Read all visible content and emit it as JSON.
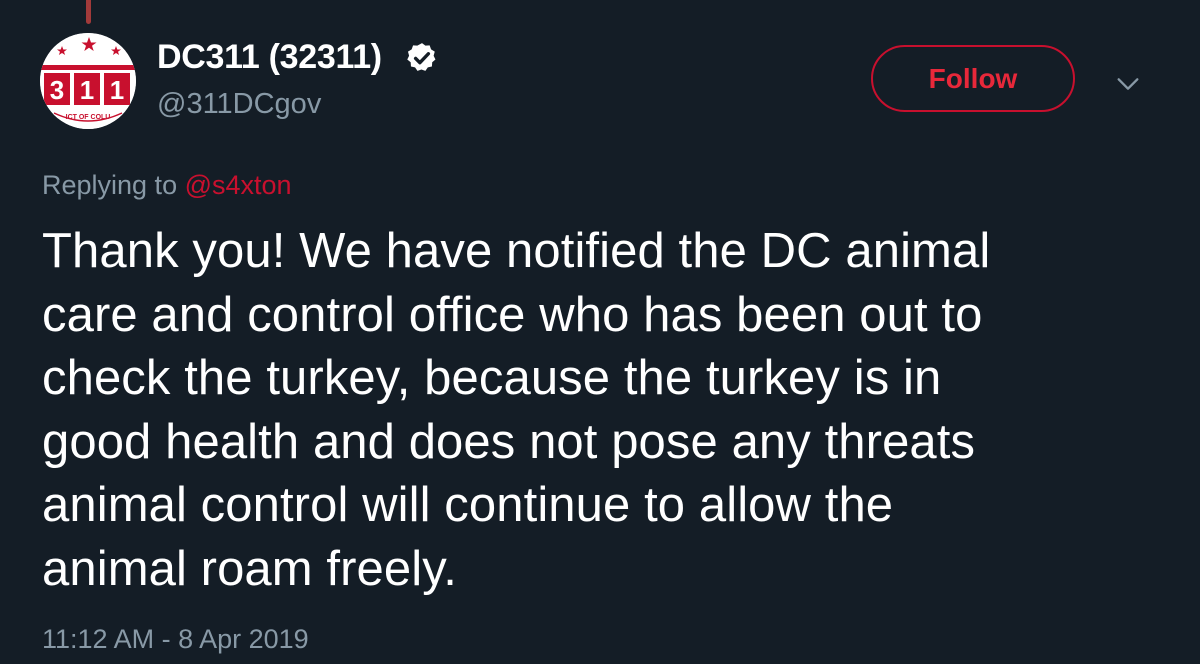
{
  "colors": {
    "background": "#141d26",
    "brand_red": "#c8102e",
    "secondary_text": "#8899a6"
  },
  "author": {
    "display_name": "DC311 (32311)",
    "handle": "@311DCgov",
    "verified_icon": "verified-badge-icon",
    "avatar": {
      "logo_digits": [
        "3",
        "1",
        "1"
      ],
      "logo_ring_text": "DISTRICT OF COLUMBIA"
    }
  },
  "actions": {
    "follow_label": "Follow",
    "more_icon": "chevron-down-icon"
  },
  "reply": {
    "prefix": "Replying to",
    "mention": "@s4xton"
  },
  "tweet": {
    "text": "Thank you! We have notified the DC animal\ncare and control office who has been out to\ncheck the turkey, because the turkey is in\ngood health and does not pose any threats\nanimal control will continue to allow the\nanimal roam freely.",
    "timestamp": "11:12 AM - 8 Apr 2019"
  }
}
